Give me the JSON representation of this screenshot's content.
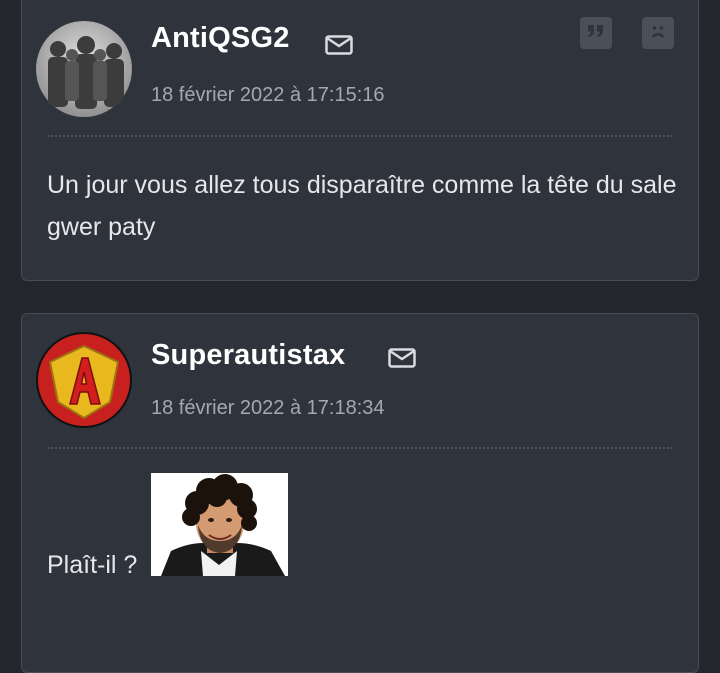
{
  "posts": [
    {
      "author": "AntiQSG2",
      "date": "18 février 2022 à 17:15:16",
      "message": "Un jour vous allez tous disparaître comme la tête du sale gwer paty",
      "avatar": "group-silhouette-avatar",
      "actions": [
        "quote-icon",
        "sad-face-icon"
      ]
    },
    {
      "author": "Superautistax",
      "date": "18 février 2022 à 17:18:34",
      "message": "Plaît-il ?",
      "avatar": "superhero-A-logo-avatar",
      "attachment": "sticker-curly-hair-man"
    }
  ],
  "colors": {
    "page_bg": "#24262b",
    "card_bg": "#2f333c",
    "card_border": "#474c57",
    "author": "#ffffff",
    "date": "#a4a8b0",
    "text": "#e6e7ea"
  }
}
